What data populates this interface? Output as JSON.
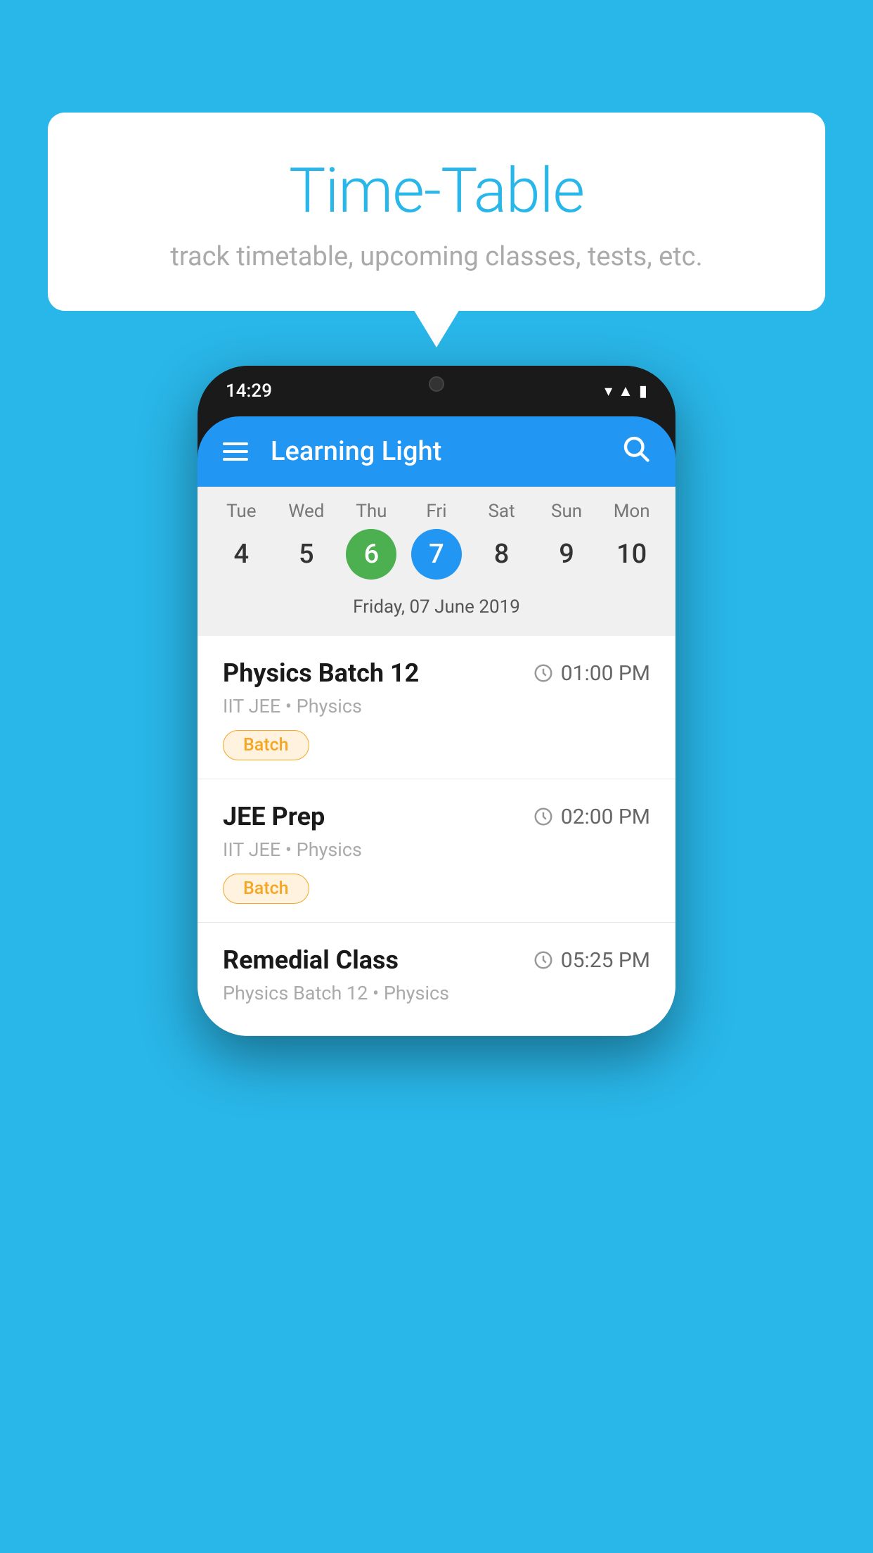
{
  "background": {
    "color": "#29b6e8"
  },
  "speech_bubble": {
    "title": "Time-Table",
    "subtitle": "track timetable, upcoming classes, tests, etc."
  },
  "phone": {
    "status_bar": {
      "time": "14:29"
    },
    "toolbar": {
      "app_name": "Learning Light",
      "menu_icon": "hamburger-icon",
      "search_icon": "search-icon"
    },
    "calendar": {
      "selected_date_label": "Friday, 07 June 2019",
      "days": [
        {
          "label": "Tue",
          "number": "4",
          "state": "normal"
        },
        {
          "label": "Wed",
          "number": "5",
          "state": "normal"
        },
        {
          "label": "Thu",
          "number": "6",
          "state": "today"
        },
        {
          "label": "Fri",
          "number": "7",
          "state": "selected"
        },
        {
          "label": "Sat",
          "number": "8",
          "state": "normal"
        },
        {
          "label": "Sun",
          "number": "9",
          "state": "normal"
        },
        {
          "label": "Mon",
          "number": "10",
          "state": "normal"
        }
      ]
    },
    "classes": [
      {
        "name": "Physics Batch 12",
        "time": "01:00 PM",
        "subject_line": "IIT JEE • Physics",
        "badge": "Batch"
      },
      {
        "name": "JEE Prep",
        "time": "02:00 PM",
        "subject_line": "IIT JEE • Physics",
        "badge": "Batch"
      },
      {
        "name": "Remedial Class",
        "time": "05:25 PM",
        "subject_line": "Physics Batch 12 • Physics",
        "badge": null
      }
    ]
  }
}
